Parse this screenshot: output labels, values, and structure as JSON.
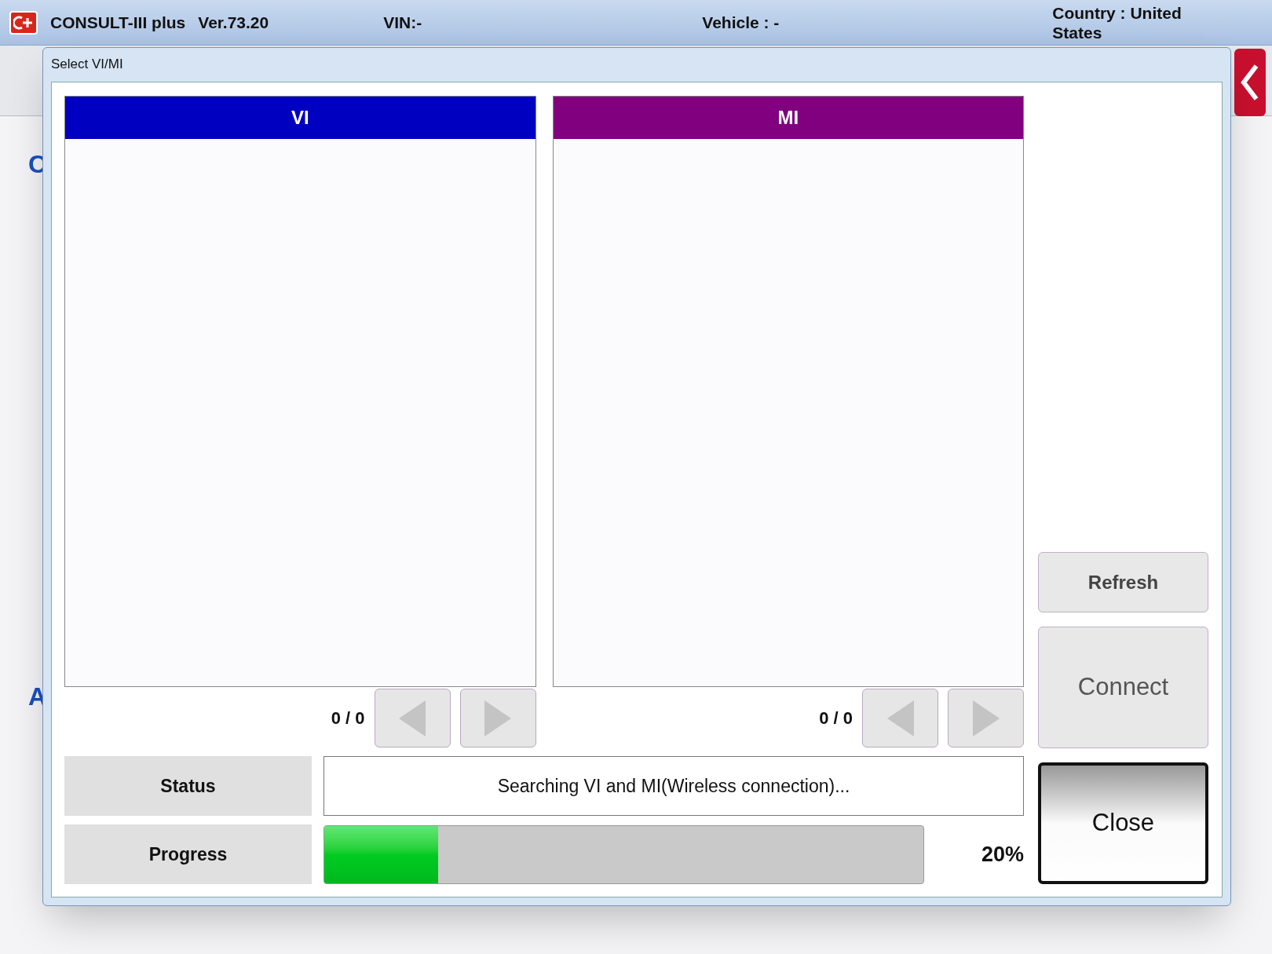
{
  "app_bar": {
    "app_name": "CONSULT-III plus",
    "version": "Ver.73.20",
    "vin": "VIN:-",
    "vehicle": "Vehicle : -",
    "country": "Country : United States"
  },
  "background": {
    "headings": [
      "C",
      "A"
    ]
  },
  "dialog": {
    "title": "Select VI/MI",
    "panels": [
      {
        "header": "VI",
        "color": "#0000c0",
        "count": "0 / 0"
      },
      {
        "header": "MI",
        "color": "#800080",
        "count": "0 / 0"
      }
    ],
    "status": {
      "label": "Status",
      "value": "Searching VI and MI(Wireless connection)..."
    },
    "progress": {
      "label": "Progress",
      "level": 0.19,
      "reading": "20%"
    },
    "buttons": [
      {
        "label": "Refresh",
        "kind": "flat"
      },
      {
        "label": "Connect",
        "kind": "large"
      },
      {
        "label": "Close",
        "kind": "primary"
      }
    ]
  }
}
